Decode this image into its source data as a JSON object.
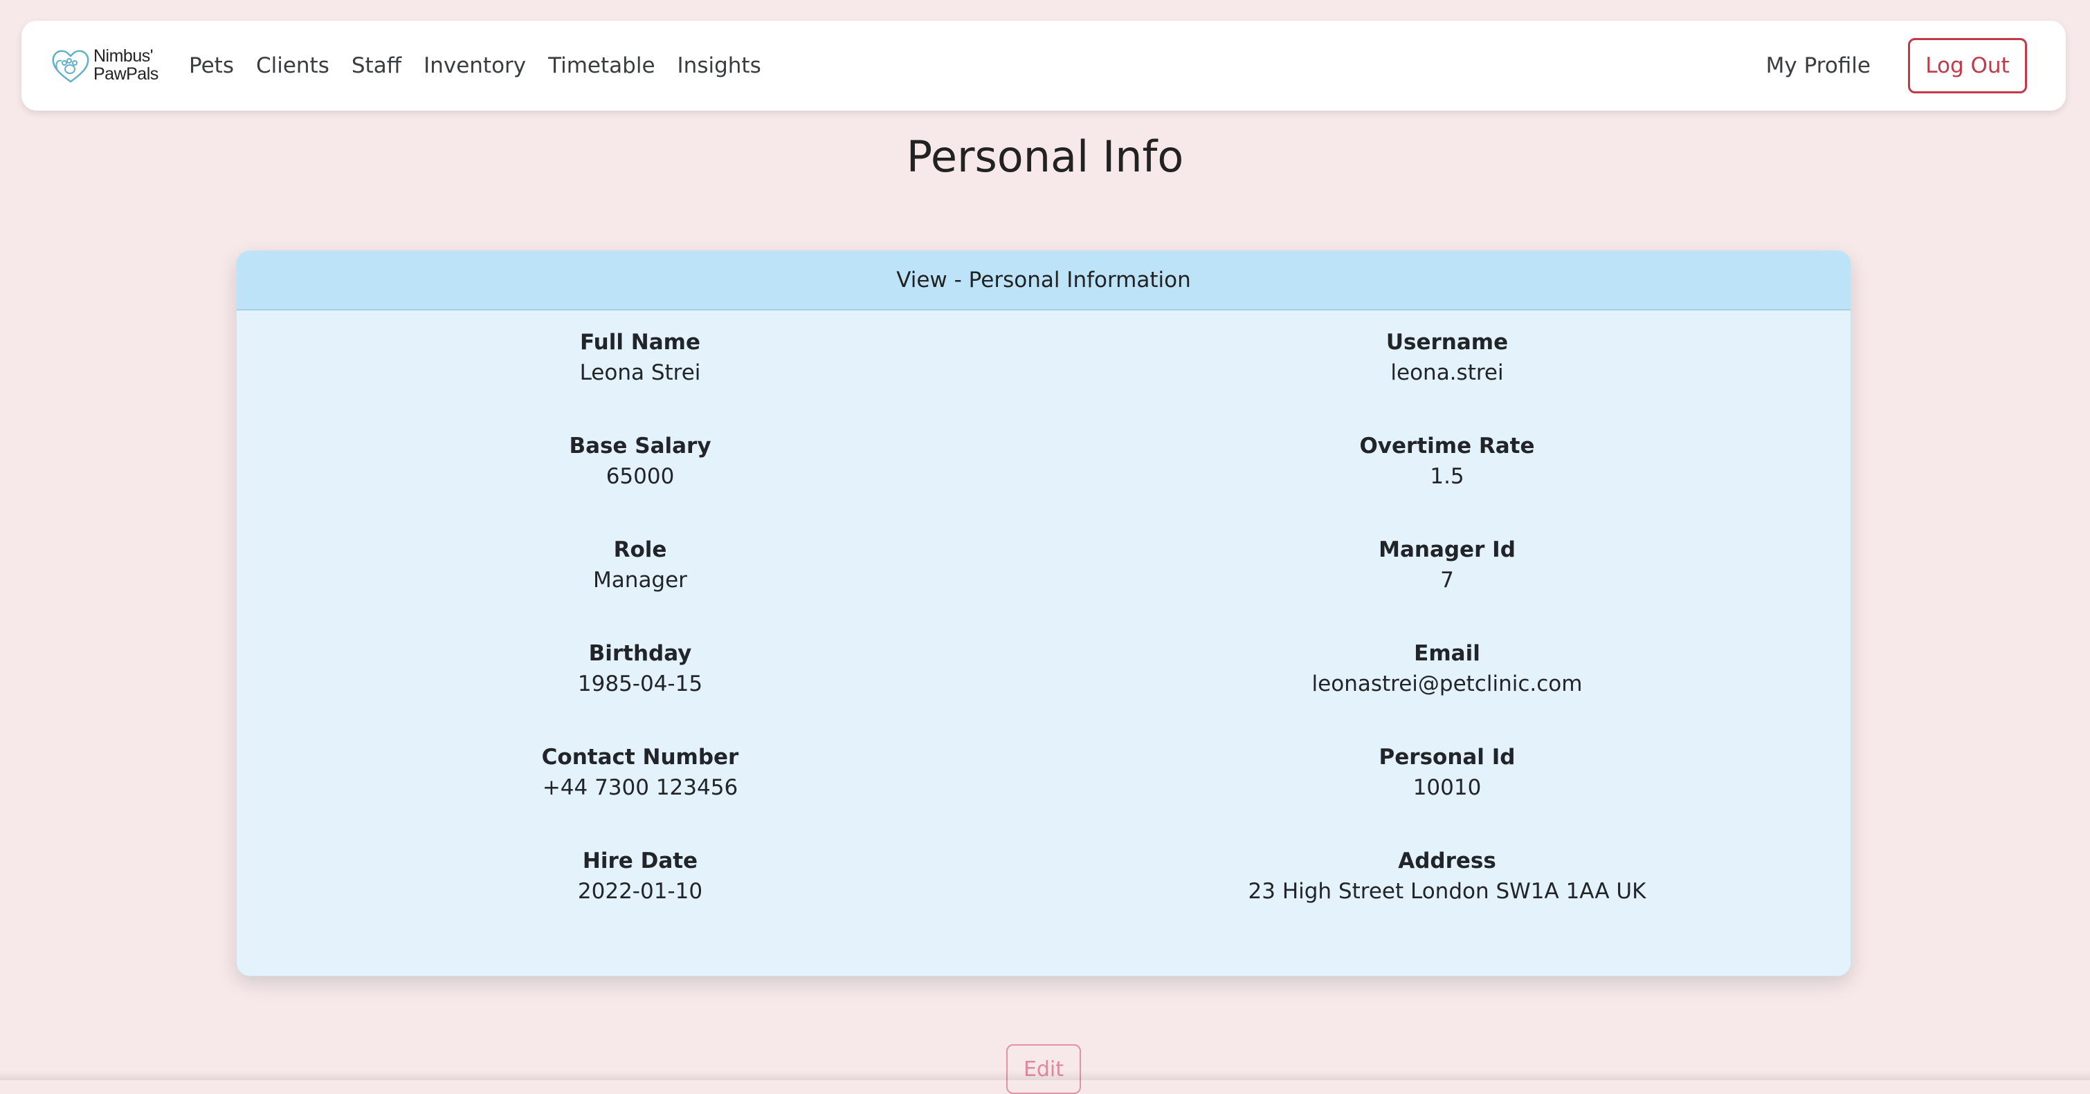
{
  "nav": {
    "brand_line1": "Nimbus'",
    "brand_line2": "PawPals",
    "links": [
      "Pets",
      "Clients",
      "Staff",
      "Inventory",
      "Timetable",
      "Insights"
    ],
    "profile_label": "My Profile",
    "logout_label": "Log Out"
  },
  "page_title": "Personal Info",
  "card": {
    "header": "View - Personal Information",
    "fields": [
      {
        "label": "Full Name",
        "value": "Leona Strei"
      },
      {
        "label": "Username",
        "value": "leona.strei"
      },
      {
        "label": "Base Salary",
        "value": "65000"
      },
      {
        "label": "Overtime Rate",
        "value": "1.5"
      },
      {
        "label": "Role",
        "value": "Manager"
      },
      {
        "label": "Manager Id",
        "value": "7"
      },
      {
        "label": "Birthday",
        "value": "1985-04-15"
      },
      {
        "label": "Email",
        "value": "leonastrei@petclinic.com"
      },
      {
        "label": "Contact Number",
        "value": "+44 7300 123456"
      },
      {
        "label": "Personal Id",
        "value": "10010"
      },
      {
        "label": "Hire Date",
        "value": "2022-01-10"
      },
      {
        "label": "Address",
        "value": "23 High Street London SW1A 1AA UK"
      }
    ]
  },
  "edit_label": "Edit",
  "colors": {
    "page_background": "#f7e9ea",
    "card_background": "#e3f2fb",
    "card_header": "#bde3f8",
    "logout_red": "#c23a48",
    "edit_pink": "#e2889c",
    "logo_teal": "#5fb0c9"
  }
}
